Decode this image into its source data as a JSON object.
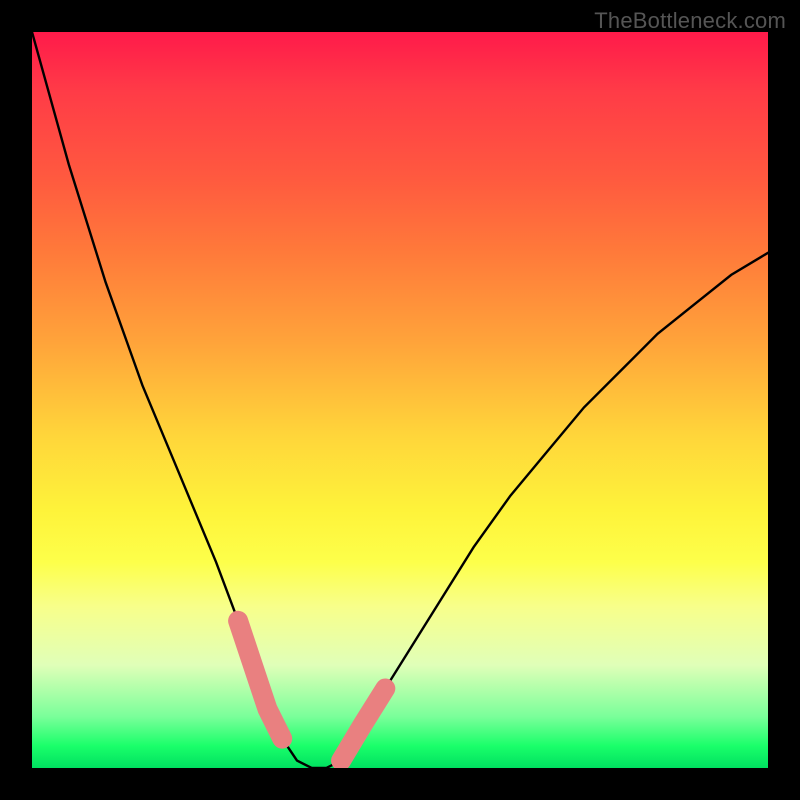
{
  "watermark": "TheBottleneck.com",
  "chart_data": {
    "type": "line",
    "title": "",
    "xlabel": "",
    "ylabel": "",
    "xlim": [
      0,
      100
    ],
    "ylim": [
      0,
      100
    ],
    "series": [
      {
        "name": "bottleneck-curve",
        "x": [
          0,
          5,
          10,
          15,
          20,
          25,
          28,
          30,
          32,
          34,
          36,
          38,
          40,
          42,
          45,
          50,
          55,
          60,
          65,
          70,
          75,
          80,
          85,
          90,
          95,
          100
        ],
        "y": [
          100,
          82,
          66,
          52,
          40,
          28,
          20,
          14,
          8,
          4,
          1,
          0,
          0,
          1,
          6,
          14,
          22,
          30,
          37,
          43,
          49,
          54,
          59,
          63,
          67,
          70
        ]
      }
    ],
    "highlight_segments": [
      {
        "name": "left-bump-segment",
        "x_range": [
          28,
          34
        ]
      },
      {
        "name": "right-bump-segment",
        "x_range": [
          42,
          48
        ]
      }
    ],
    "gradient_colors": {
      "top": "#ff1a4a",
      "mid": "#fef33a",
      "bottom": "#00e060"
    }
  }
}
